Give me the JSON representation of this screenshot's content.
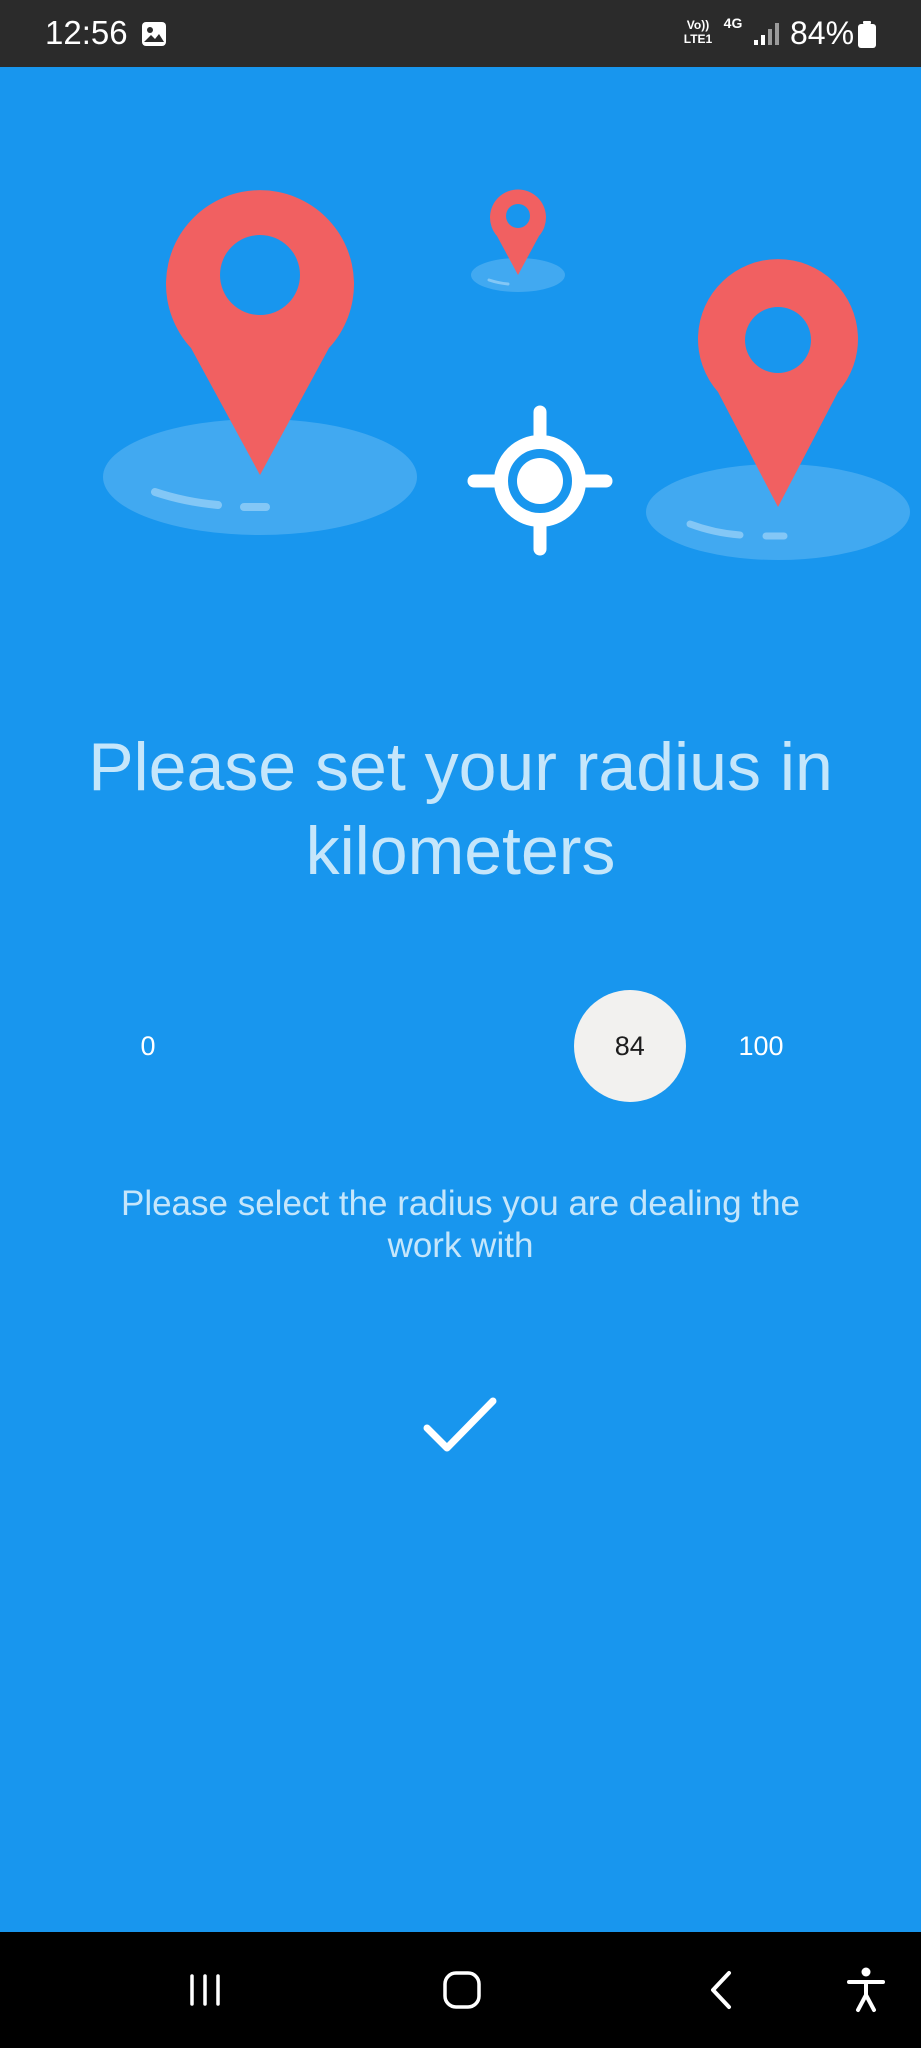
{
  "status_bar": {
    "time": "12:56",
    "network_volte": "Vo)) LTE1",
    "network_type": "4G",
    "battery_percent": "84%",
    "icons": [
      "gallery-icon",
      "signal-icon",
      "battery-icon"
    ]
  },
  "hero": {
    "illustration": [
      "location-pin-icon",
      "location-pin-icon",
      "location-pin-icon",
      "crosshair-icon"
    ]
  },
  "main": {
    "title": "Please set your radius in kilometers",
    "slider": {
      "min_label": "0",
      "max_label": "100",
      "value": "84",
      "value_fraction": 0.84
    },
    "subtitle": "Please select the radius you are dealing the work with",
    "confirm_icon": "checkmark-icon"
  },
  "nav_bar": {
    "buttons": [
      "recent-apps-icon",
      "home-icon",
      "back-icon",
      "accessibility-icon"
    ]
  },
  "colors": {
    "background": "#1896ee",
    "pin": "#f16061",
    "text_light": "#c5e6fb",
    "thumb": "#f2f1ef",
    "status_bar": "#2b2b2b",
    "nav_bar": "#000000"
  }
}
